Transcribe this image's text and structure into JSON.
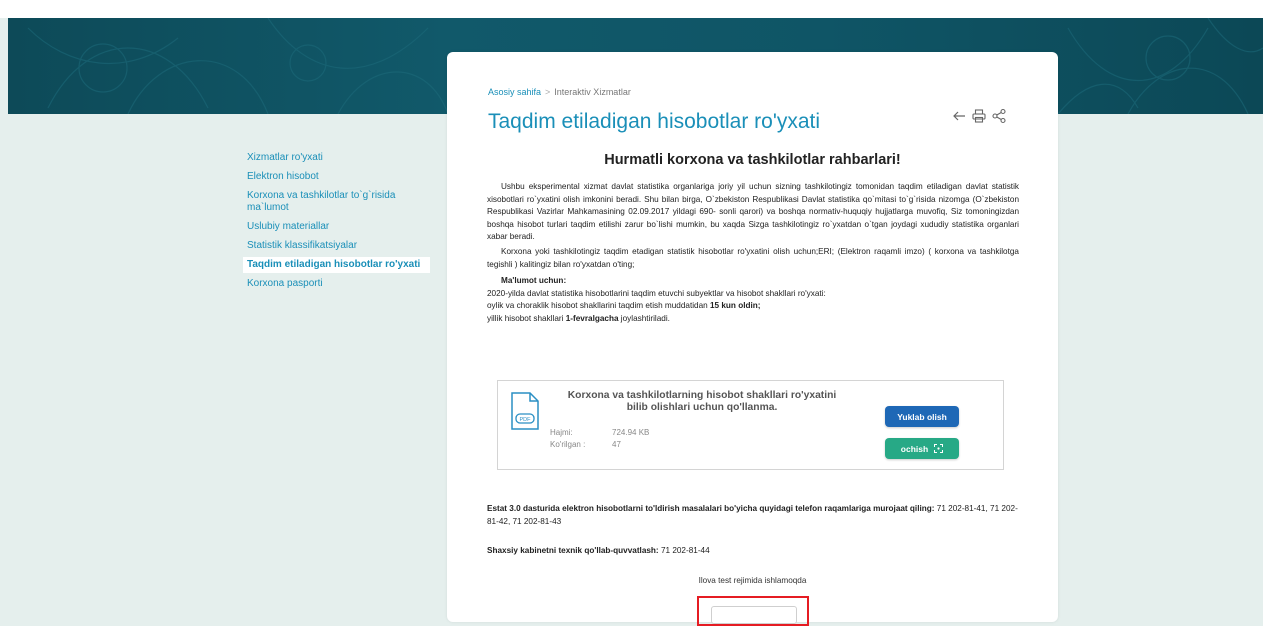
{
  "sidebar": {
    "items": [
      {
        "label": "Xizmatlar ro'yxati",
        "active": false
      },
      {
        "label": "Elektron hisobot",
        "active": false
      },
      {
        "label": "Korxona va tashkilotlar to`g`risida ma`lumot",
        "active": false
      },
      {
        "label": "Uslubiy materiallar",
        "active": false
      },
      {
        "label": "Statistik klassifikatsiyalar",
        "active": false
      },
      {
        "label": "Taqdim etiladigan hisobotlar ro'yxati",
        "active": true
      },
      {
        "label": "Korxona pasporti",
        "active": false
      }
    ]
  },
  "breadcrumb": {
    "home": "Asosiy sahifa",
    "separator": ">",
    "current": "Interaktiv Xizmatlar"
  },
  "page_title": "Taqdim etiladigan hisobotlar ro'yxati",
  "actions": {
    "icons": [
      "back-arrow-icon",
      "print-icon",
      "share-icon"
    ]
  },
  "heading": "Hurmatli korxona va tashkilotlar rahbarlari!",
  "paragraphs": {
    "p1": "Ushbu eksperimental xizmat davlat statistika organlariga joriy yil uchun sizning tashkilotingiz tomonidan taqdim etiladigan davlat statistik xisobotlari ro`yxatini olish imkonini beradi. Shu bilan birga, O`zbekiston Respublikasi Davlat statistika qo`mitasi to`g`risida nizomga (O`zbekiston Respublikasi Vazirlar Mahkamasining 02.09.2017 yildagi 690- sonli qarori) va boshqa normativ-huquqiy hujjatlarga muvofiq, Siz tomoningizdan boshqa hisobot turlari taqdim etilishi zarur bo`lishi mumkin, bu xaqda Sizga tashkilotingiz ro`yxatdan o`tgan joydagi xududiy statistika organlari xabar beradi.",
    "p2": "Korxona yoki tashkilotingiz taqdim etadigan statistik hisobotlar ro'yxatini olish uchun;ERI; (Elektron raqamli imzo) ( korxona va tashkilotga tegishli ) kalitingiz bilan ro'yxatdan o'ting;",
    "info_title": "Ma'lumot uchun:",
    "info_line1": "2020-yilda davlat statistika hisobotlarini taqdim etuvchi subyektlar va hisobot shakllari ro'yxati:",
    "info_line2_prefix": "oylik va choraklik hisobot shakllarini taqdim etish muddatidan ",
    "info_line2_bold": "15 kun oldin;",
    "info_line3_prefix": "yillik hisobot shakllari ",
    "info_line3_bold": "1-fevralgacha",
    "info_line3_suffix": " joylashtiriladi."
  },
  "download": {
    "title": "Korxona va tashkilotlarning hisobot shakllari ro'yxatini bilib olishlari uchun qo'llanma.",
    "file_badge": "PDF",
    "size_label": "Hajmi:",
    "size_value": "724.94 KB",
    "views_label": "Ko'rilgan :",
    "views_value": "47",
    "download_button": "Yuklab olish",
    "open_button": "ochish"
  },
  "contacts": {
    "line1_bold": "Estat 3.0 dasturida elektron hisobotlarni to'ldirish masalalari bo'yicha quyidagi telefon raqamlariga murojaat qiling:",
    "line1_numbers": " 71 202-81-41, 71 202-81-42, 71 202-81-43",
    "line2_bold": "Shaxsiy kabinetni texnik qo'llab-quvvatlash:",
    "line2_number": " 71 202-81-44"
  },
  "test_mode": "Ilova test rejimida ishlamoqda",
  "colors": {
    "accent": "#1a8fb8",
    "download_button": "#1e68b6",
    "open_button": "#27a986",
    "highlight_frame": "#e51c23"
  }
}
